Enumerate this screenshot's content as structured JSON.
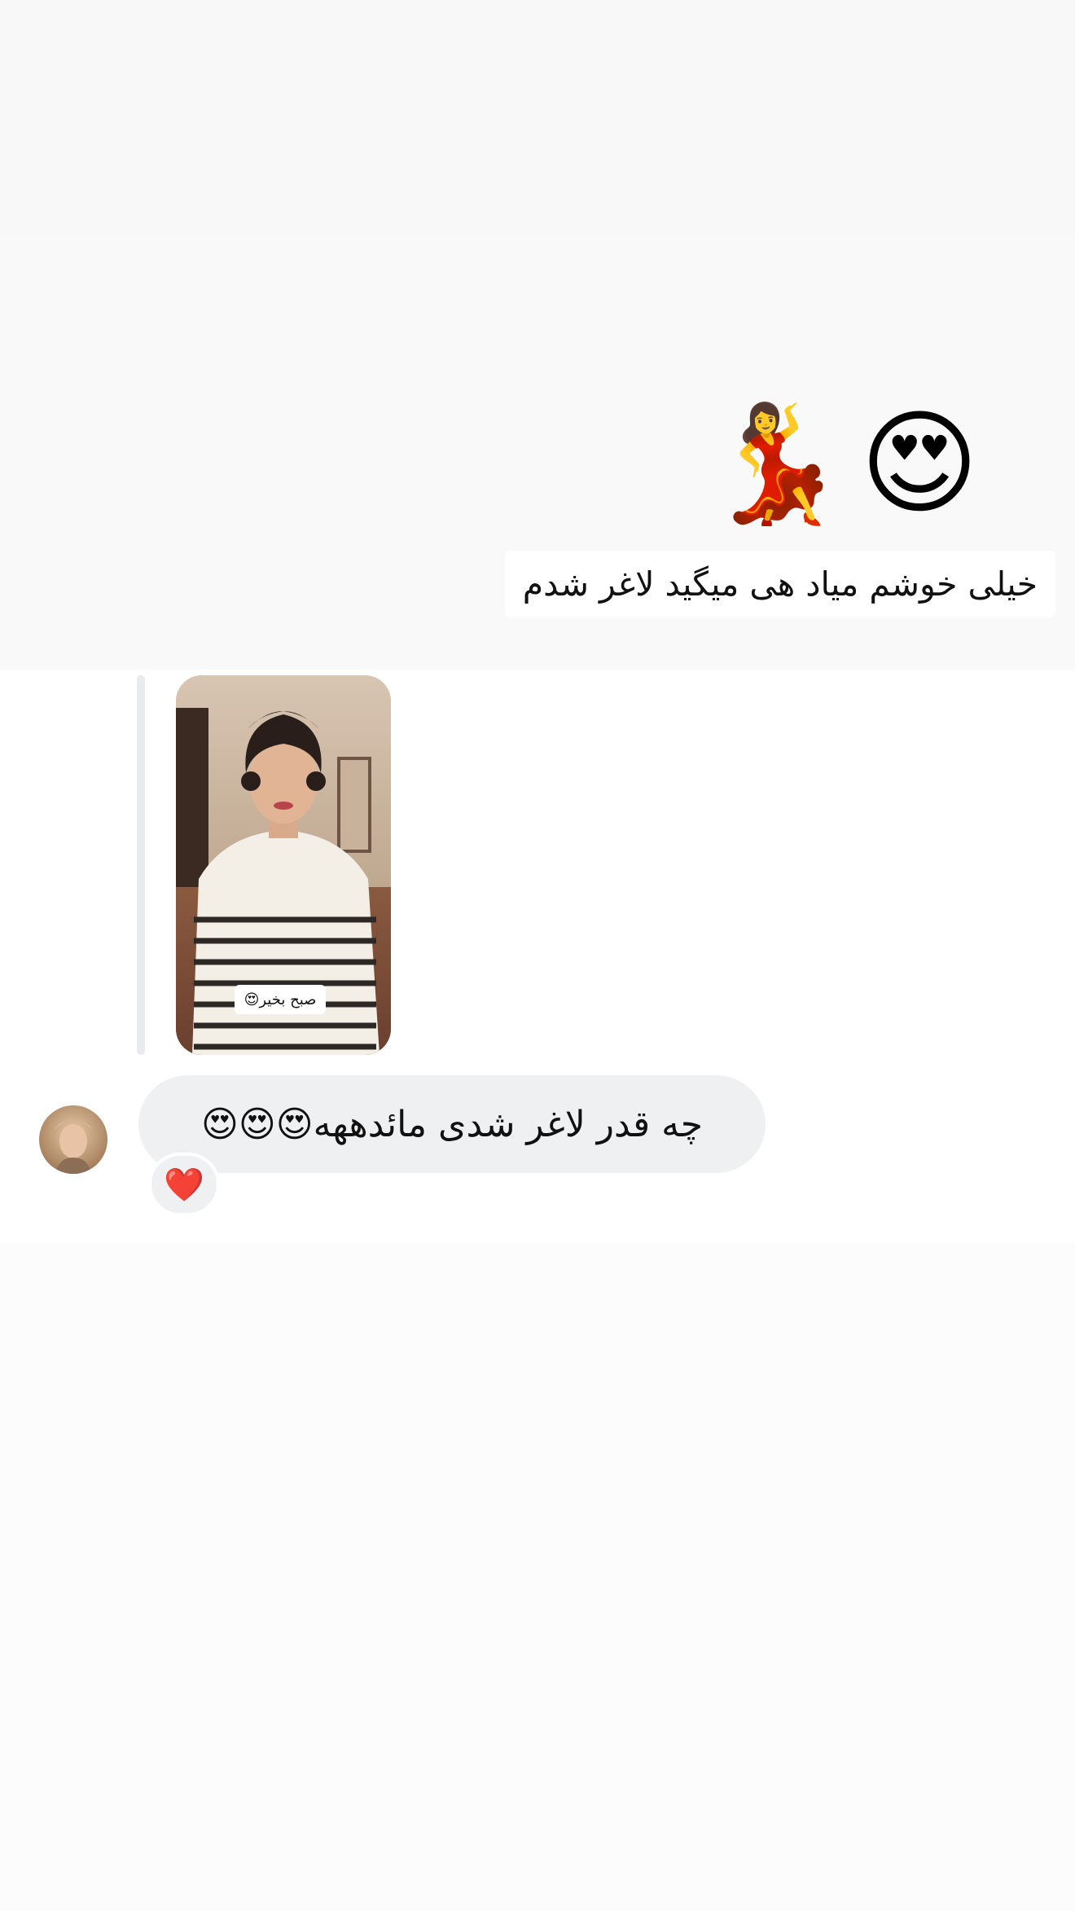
{
  "story": {
    "emojis": [
      "💃",
      "😍"
    ],
    "text": "خیلی خوشم میاد هی میگید لاغر شدم"
  },
  "reply": {
    "sticker_text": "صبح بخیر😍"
  },
  "message": {
    "text": "چه قدر لاغر شدی مائدههه😍😍😍",
    "reaction": "❤️"
  },
  "colors": {
    "bubble_bg": "#eff0f2",
    "reaction_heart": "#e2142d",
    "reply_bar": "#e9eaec"
  }
}
